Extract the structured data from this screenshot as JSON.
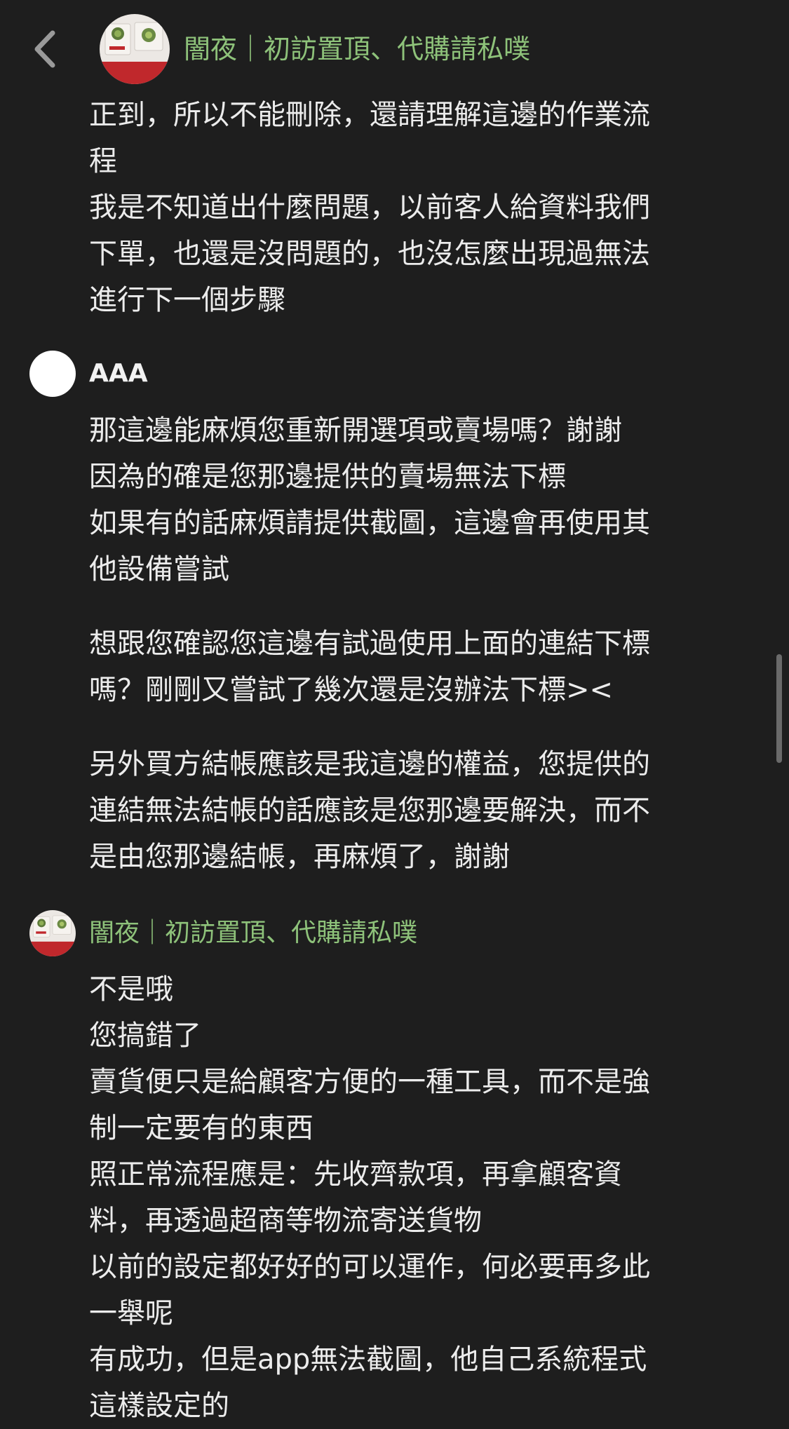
{
  "header": {
    "title": "闇夜｜初訪置頂、代購請私噗"
  },
  "icons": {
    "back": "chevron-left-icon",
    "store_avatar": "store-avatar-image"
  },
  "colors": {
    "background": "#1e1e1e",
    "text": "#ececec",
    "store_name": "#8ec27a"
  },
  "messages": [
    {
      "sender": "",
      "lines": [
        "正到，所以不能刪除，還請理解這邊的作業流",
        "程",
        "我是不知道出什麼問題，以前客人給資料我們",
        "下單，也還是沒問題的，也沒怎麼出現過無法",
        "進行下一個步驟"
      ]
    },
    {
      "sender": "AAA",
      "lines": [
        "那這邊能麻煩您重新開選項或賣場嗎？謝謝",
        "因為的確是您那邊提供的賣場無法下標",
        "如果有的話麻煩請提供截圖，這邊會再使用其",
        "他設備嘗試",
        "",
        "想跟您確認您這邊有試過使用上面的連結下標",
        "嗎？剛剛又嘗試了幾次還是沒辦法下標><",
        "",
        "另外買方結帳應該是我這邊的權益，您提供的",
        "連結無法結帳的話應該是您那邊要解決，而不",
        "是由您那邊結帳，再麻煩了，謝謝"
      ]
    },
    {
      "sender": "闇夜｜初訪置頂、代購請私噗",
      "lines": [
        "不是哦",
        "您搞錯了",
        "賣貨便只是給顧客方便的一種工具，而不是強",
        "制一定要有的東西",
        "照正常流程應是：先收齊款項，再拿顧客資",
        "料，再透過超商等物流寄送貨物",
        "以前的設定都好好的可以運作，何必要再多此",
        "一舉呢",
        "有成功，但是app無法截圖，他自己系統程式",
        "這樣設定的"
      ]
    }
  ]
}
